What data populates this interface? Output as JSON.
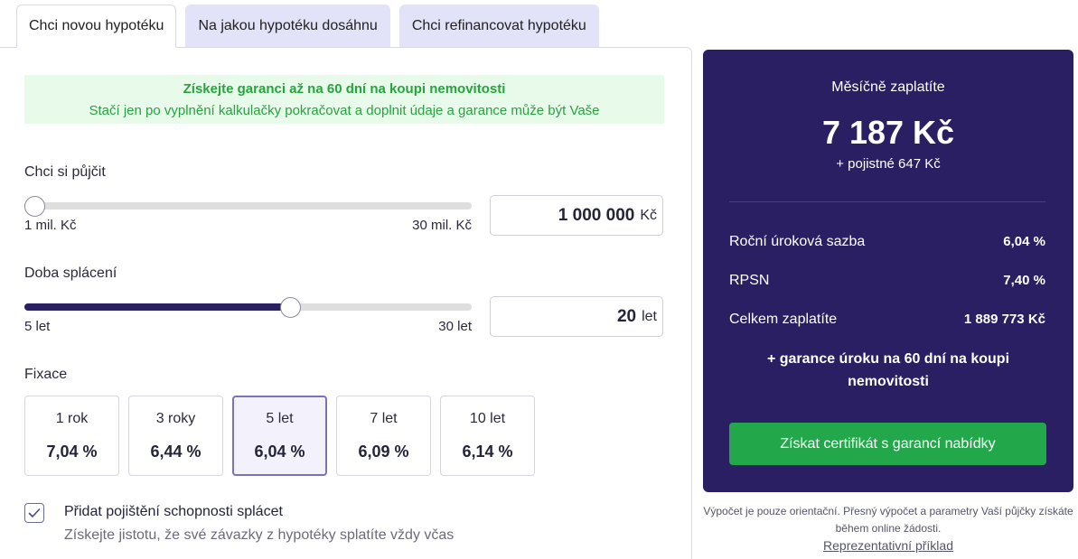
{
  "tabs": [
    {
      "label": "Chci novou hypotéku",
      "active": true
    },
    {
      "label": "Na jakou hypotéku dosáhnu",
      "active": false
    },
    {
      "label": "Chci refinancovat hypotéku",
      "active": false
    }
  ],
  "promo": {
    "title": "Získejte garanci až na 60 dní na koupi nemovitosti",
    "text": "Stačí jen po vyplnění kalkulačky pokračovat a doplnit údaje a garance může být Vaše"
  },
  "loan": {
    "label": "Chci si půjčit",
    "min_label": "1 mil. Kč",
    "max_label": "30 mil. Kč",
    "value": "1 000 000",
    "unit": "Kč",
    "fraction": 0.0
  },
  "term": {
    "label": "Doba splácení",
    "min_label": "5 let",
    "max_label": "30 let",
    "value": "20",
    "unit": "let",
    "fraction": 0.6
  },
  "fixation": {
    "label": "Fixace",
    "options": [
      {
        "term": "1 rok",
        "rate": "7,04 %",
        "selected": false
      },
      {
        "term": "3 roky",
        "rate": "6,44 %",
        "selected": false
      },
      {
        "term": "5 let",
        "rate": "6,04 %",
        "selected": true
      },
      {
        "term": "7 let",
        "rate": "6,09 %",
        "selected": false
      },
      {
        "term": "10 let",
        "rate": "6,14 %",
        "selected": false
      }
    ]
  },
  "insurance": {
    "checked": true,
    "label": "Přidat pojištění schopnosti splácet",
    "note": "Získejte jistotu, že své závazky z hypotéky splatíte vždy včas"
  },
  "summary": {
    "title": "Měsíčně zaplatíte",
    "amount": "7 187 Kč",
    "insurance": "+ pojistné 647 Kč",
    "rows": [
      {
        "label": "Roční úroková sazba",
        "value": "6,04 %"
      },
      {
        "label": "RPSN",
        "value": "7,40 %"
      },
      {
        "label": "Celkem zaplatíte",
        "value": "1 889 773 Kč"
      }
    ],
    "guarantee": "+ garance úroku na 60 dní na koupi nemovitosti",
    "cta_label": "Získat certifikát s garancí nabídky"
  },
  "footnote": "Výpočet je pouze orientační. Přesný výpočet a parametry Vaší půjčky získáte během online žádosti.",
  "footlink": "Reprezentativní příklad",
  "colors": {
    "brand_dark": "#2b1f63",
    "cta_green": "#22a84a",
    "promo_bg": "#e8fbea",
    "promo_text": "#27a33f",
    "tab_inactive": "#e2e2f8"
  }
}
